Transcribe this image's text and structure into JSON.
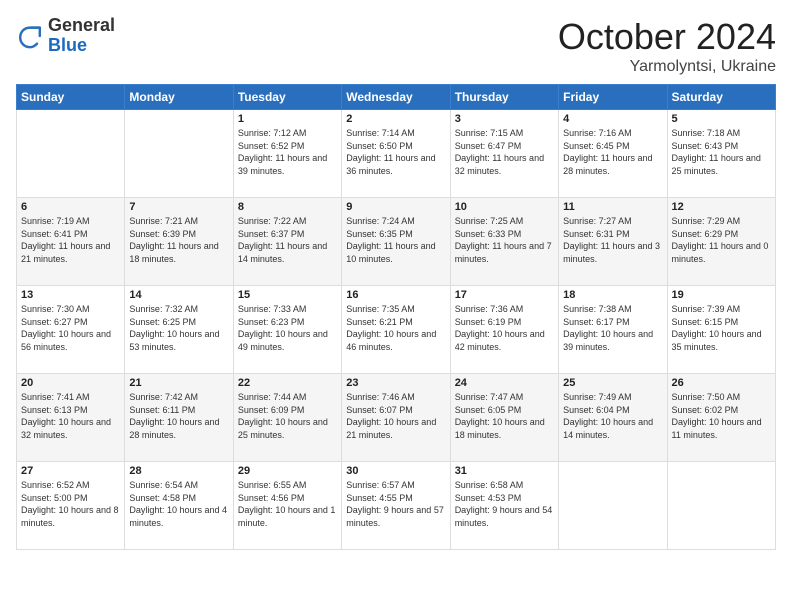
{
  "header": {
    "logo_general": "General",
    "logo_blue": "Blue",
    "month_title": "October 2024",
    "subtitle": "Yarmolyntsi, Ukraine"
  },
  "weekdays": [
    "Sunday",
    "Monday",
    "Tuesday",
    "Wednesday",
    "Thursday",
    "Friday",
    "Saturday"
  ],
  "weeks": [
    [
      {
        "day": "",
        "sunrise": "",
        "sunset": "",
        "daylight": ""
      },
      {
        "day": "",
        "sunrise": "",
        "sunset": "",
        "daylight": ""
      },
      {
        "day": "1",
        "sunrise": "Sunrise: 7:12 AM",
        "sunset": "Sunset: 6:52 PM",
        "daylight": "Daylight: 11 hours and 39 minutes."
      },
      {
        "day": "2",
        "sunrise": "Sunrise: 7:14 AM",
        "sunset": "Sunset: 6:50 PM",
        "daylight": "Daylight: 11 hours and 36 minutes."
      },
      {
        "day": "3",
        "sunrise": "Sunrise: 7:15 AM",
        "sunset": "Sunset: 6:47 PM",
        "daylight": "Daylight: 11 hours and 32 minutes."
      },
      {
        "day": "4",
        "sunrise": "Sunrise: 7:16 AM",
        "sunset": "Sunset: 6:45 PM",
        "daylight": "Daylight: 11 hours and 28 minutes."
      },
      {
        "day": "5",
        "sunrise": "Sunrise: 7:18 AM",
        "sunset": "Sunset: 6:43 PM",
        "daylight": "Daylight: 11 hours and 25 minutes."
      }
    ],
    [
      {
        "day": "6",
        "sunrise": "Sunrise: 7:19 AM",
        "sunset": "Sunset: 6:41 PM",
        "daylight": "Daylight: 11 hours and 21 minutes."
      },
      {
        "day": "7",
        "sunrise": "Sunrise: 7:21 AM",
        "sunset": "Sunset: 6:39 PM",
        "daylight": "Daylight: 11 hours and 18 minutes."
      },
      {
        "day": "8",
        "sunrise": "Sunrise: 7:22 AM",
        "sunset": "Sunset: 6:37 PM",
        "daylight": "Daylight: 11 hours and 14 minutes."
      },
      {
        "day": "9",
        "sunrise": "Sunrise: 7:24 AM",
        "sunset": "Sunset: 6:35 PM",
        "daylight": "Daylight: 11 hours and 10 minutes."
      },
      {
        "day": "10",
        "sunrise": "Sunrise: 7:25 AM",
        "sunset": "Sunset: 6:33 PM",
        "daylight": "Daylight: 11 hours and 7 minutes."
      },
      {
        "day": "11",
        "sunrise": "Sunrise: 7:27 AM",
        "sunset": "Sunset: 6:31 PM",
        "daylight": "Daylight: 11 hours and 3 minutes."
      },
      {
        "day": "12",
        "sunrise": "Sunrise: 7:29 AM",
        "sunset": "Sunset: 6:29 PM",
        "daylight": "Daylight: 11 hours and 0 minutes."
      }
    ],
    [
      {
        "day": "13",
        "sunrise": "Sunrise: 7:30 AM",
        "sunset": "Sunset: 6:27 PM",
        "daylight": "Daylight: 10 hours and 56 minutes."
      },
      {
        "day": "14",
        "sunrise": "Sunrise: 7:32 AM",
        "sunset": "Sunset: 6:25 PM",
        "daylight": "Daylight: 10 hours and 53 minutes."
      },
      {
        "day": "15",
        "sunrise": "Sunrise: 7:33 AM",
        "sunset": "Sunset: 6:23 PM",
        "daylight": "Daylight: 10 hours and 49 minutes."
      },
      {
        "day": "16",
        "sunrise": "Sunrise: 7:35 AM",
        "sunset": "Sunset: 6:21 PM",
        "daylight": "Daylight: 10 hours and 46 minutes."
      },
      {
        "day": "17",
        "sunrise": "Sunrise: 7:36 AM",
        "sunset": "Sunset: 6:19 PM",
        "daylight": "Daylight: 10 hours and 42 minutes."
      },
      {
        "day": "18",
        "sunrise": "Sunrise: 7:38 AM",
        "sunset": "Sunset: 6:17 PM",
        "daylight": "Daylight: 10 hours and 39 minutes."
      },
      {
        "day": "19",
        "sunrise": "Sunrise: 7:39 AM",
        "sunset": "Sunset: 6:15 PM",
        "daylight": "Daylight: 10 hours and 35 minutes."
      }
    ],
    [
      {
        "day": "20",
        "sunrise": "Sunrise: 7:41 AM",
        "sunset": "Sunset: 6:13 PM",
        "daylight": "Daylight: 10 hours and 32 minutes."
      },
      {
        "day": "21",
        "sunrise": "Sunrise: 7:42 AM",
        "sunset": "Sunset: 6:11 PM",
        "daylight": "Daylight: 10 hours and 28 minutes."
      },
      {
        "day": "22",
        "sunrise": "Sunrise: 7:44 AM",
        "sunset": "Sunset: 6:09 PM",
        "daylight": "Daylight: 10 hours and 25 minutes."
      },
      {
        "day": "23",
        "sunrise": "Sunrise: 7:46 AM",
        "sunset": "Sunset: 6:07 PM",
        "daylight": "Daylight: 10 hours and 21 minutes."
      },
      {
        "day": "24",
        "sunrise": "Sunrise: 7:47 AM",
        "sunset": "Sunset: 6:05 PM",
        "daylight": "Daylight: 10 hours and 18 minutes."
      },
      {
        "day": "25",
        "sunrise": "Sunrise: 7:49 AM",
        "sunset": "Sunset: 6:04 PM",
        "daylight": "Daylight: 10 hours and 14 minutes."
      },
      {
        "day": "26",
        "sunrise": "Sunrise: 7:50 AM",
        "sunset": "Sunset: 6:02 PM",
        "daylight": "Daylight: 10 hours and 11 minutes."
      }
    ],
    [
      {
        "day": "27",
        "sunrise": "Sunrise: 6:52 AM",
        "sunset": "Sunset: 5:00 PM",
        "daylight": "Daylight: 10 hours and 8 minutes."
      },
      {
        "day": "28",
        "sunrise": "Sunrise: 6:54 AM",
        "sunset": "Sunset: 4:58 PM",
        "daylight": "Daylight: 10 hours and 4 minutes."
      },
      {
        "day": "29",
        "sunrise": "Sunrise: 6:55 AM",
        "sunset": "Sunset: 4:56 PM",
        "daylight": "Daylight: 10 hours and 1 minute."
      },
      {
        "day": "30",
        "sunrise": "Sunrise: 6:57 AM",
        "sunset": "Sunset: 4:55 PM",
        "daylight": "Daylight: 9 hours and 57 minutes."
      },
      {
        "day": "31",
        "sunrise": "Sunrise: 6:58 AM",
        "sunset": "Sunset: 4:53 PM",
        "daylight": "Daylight: 9 hours and 54 minutes."
      },
      {
        "day": "",
        "sunrise": "",
        "sunset": "",
        "daylight": ""
      },
      {
        "day": "",
        "sunrise": "",
        "sunset": "",
        "daylight": ""
      }
    ]
  ]
}
